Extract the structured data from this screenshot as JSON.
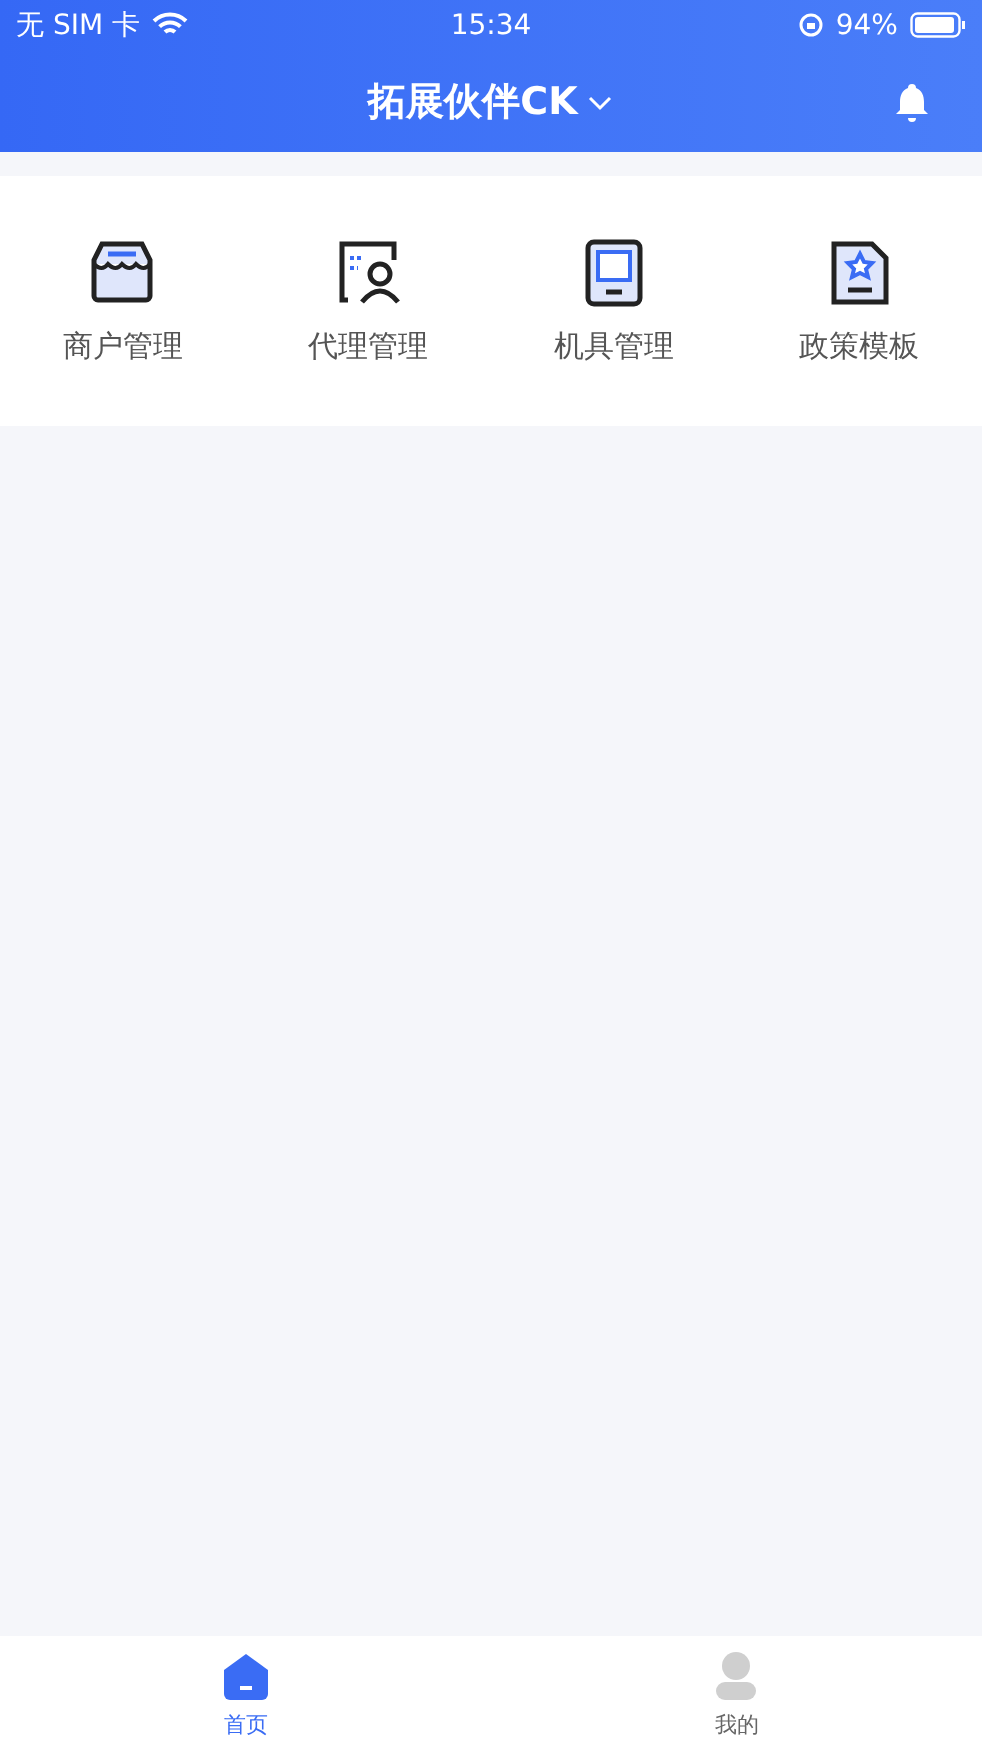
{
  "status_bar": {
    "carrier": "无 SIM 卡",
    "time": "15:34",
    "battery": "94%"
  },
  "nav_bar": {
    "title": "拓展伙伴CK"
  },
  "menu": [
    {
      "kind": "store",
      "label": "商户管理"
    },
    {
      "kind": "agent",
      "label": "代理管理"
    },
    {
      "kind": "device",
      "label": "机具管理"
    },
    {
      "kind": "policy",
      "label": "政策模板"
    }
  ],
  "tab_bar": [
    {
      "kind": "home",
      "label": "首页",
      "selected": true
    },
    {
      "kind": "profile",
      "label": "我的",
      "selected": false
    }
  ]
}
